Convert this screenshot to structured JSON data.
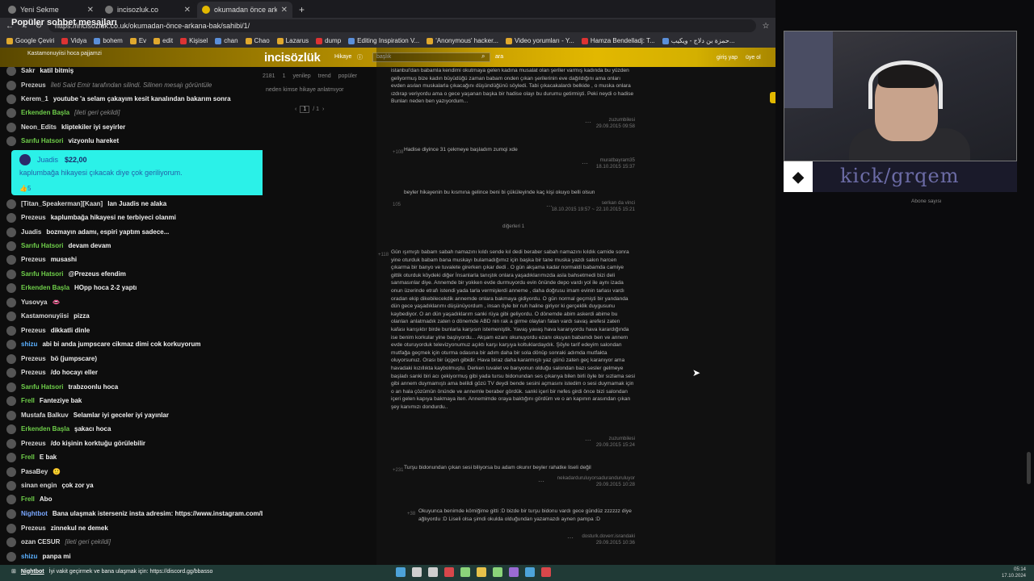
{
  "browser": {
    "tabs": [
      {
        "label": "Yeni Sekme",
        "active": false
      },
      {
        "label": "incisozluk.co",
        "active": false
      },
      {
        "label": "okumadan önce arkana bak - İ",
        "active": true
      }
    ],
    "new_tab_label": "+",
    "url": "https://incisozluk.co.uk/okumadan-önce-arkana-bak/sahibi/1/",
    "bookmarks": [
      "Google Çeviri",
      "Vidya",
      "bohem",
      "Ev",
      "edit",
      "Kişisel",
      "chan",
      "Chao",
      "Lazarus",
      "dump",
      "Editing Inspiration V...",
      "'Anonymous' hacker...",
      "Video yorumları - Y...",
      "Hamza Bendelladj: T...",
      "حمزة بن دلاج - ويكيب..."
    ]
  },
  "chat": {
    "title": "Popüler sohbet mesajları",
    "top_clip": "Kastamonuyiisi  hoca pajjamzi",
    "messages": [
      {
        "user": "Sakr",
        "text": "katil bitmiş",
        "color": "#d9d9d9",
        "muted": false
      },
      {
        "user": "Prezeus",
        "text": "İleti Said Emir tarafından silindi. Silinen mesajı görüntüle",
        "color": "#c8c8c8",
        "muted": true
      },
      {
        "user": "Kerem_1",
        "text": "youtube 'a selam çakayım kesit kanalından bakarım sonra",
        "color": "#d9d9d9",
        "muted": false
      },
      {
        "user": "Erkenden Başla",
        "text": "[ileti geri çekildi]",
        "color": "#6fcf4a",
        "muted": true
      },
      {
        "user": "Neon_Edits",
        "text": "kliptekiler iyi seyirler",
        "color": "#d9d9d9",
        "muted": false
      },
      {
        "user": "Sarıfu Hatsori",
        "text": "vizyonlu hareket",
        "color": "#6fcf4a",
        "muted": false
      },
      {
        "user": "[Titan_Speakerman][Kaan]",
        "text": "lan Juadis ne alaka",
        "color": "#d9d9d9",
        "muted": false
      },
      {
        "user": "Prezeus",
        "text": "kaplumbağa hikayesi ne terbiyeci olanmi",
        "color": "#d9d9d9",
        "muted": false
      },
      {
        "user": "Juadis",
        "text": "bozmayın adamı, espiri yaptım sadece...",
        "color": "#d9d9d9",
        "muted": false
      },
      {
        "user": "Sarıfu Hatsori",
        "text": "devam devam",
        "color": "#6fcf4a",
        "muted": false
      },
      {
        "user": "Prezeus",
        "text": "musashi",
        "color": "#d9d9d9",
        "muted": false
      },
      {
        "user": "Sarıfu Hatsori",
        "text": "@Prezeus efendim",
        "color": "#6fcf4a",
        "muted": false
      },
      {
        "user": "Erkenden Başla",
        "text": "HOpp hoca 2-2 yaptı",
        "color": "#6fcf4a",
        "muted": false
      },
      {
        "user": "Yusovya",
        "text": "👄",
        "color": "#d9d9d9",
        "muted": false
      },
      {
        "user": "Kastamonuyiisi",
        "text": "pizza",
        "color": "#d9d9d9",
        "muted": false
      },
      {
        "user": "Prezeus",
        "text": "dikkatli dinle",
        "color": "#d9d9d9",
        "muted": false
      },
      {
        "user": "shizu",
        "text": "abi bi anda jumpscare cikmaz dimi cok korkuyorum",
        "color": "#5ab0ff",
        "muted": false
      },
      {
        "user": "Prezeus",
        "text": "bö (jumpscare)",
        "color": "#d9d9d9",
        "muted": false
      },
      {
        "user": "Prezeus",
        "text": "/do hocayı eller",
        "color": "#d9d9d9",
        "muted": false
      },
      {
        "user": "Sarıfu Hatsori",
        "text": "trabzoonlu hoca",
        "color": "#6fcf4a",
        "muted": false
      },
      {
        "user": "Frell",
        "text": "Fanteziye bak",
        "color": "#6fcf4a",
        "muted": false
      },
      {
        "user": "Mustafa Balkuv",
        "text": "Selamlar iyi geceler iyi yayınlar",
        "color": "#d9d9d9",
        "muted": false
      },
      {
        "user": "Erkenden Başla",
        "text": "şakacı hoca",
        "color": "#6fcf4a",
        "muted": false
      },
      {
        "user": "Prezeus",
        "text": "/do kişinin korktuğu görülebilir",
        "color": "#d9d9d9",
        "muted": false
      },
      {
        "user": "Frell",
        "text": "E bak",
        "color": "#6fcf4a",
        "muted": false
      },
      {
        "user": "PasaBey",
        "text": "🙂",
        "color": "#d9d9d9",
        "muted": false
      },
      {
        "user": "sinan engin",
        "text": "çok zor ya",
        "color": "#d9d9d9",
        "muted": false
      },
      {
        "user": "Frell",
        "text": "Abo",
        "color": "#6fcf4a",
        "muted": false
      },
      {
        "user": "Nightbot",
        "text": "Bana ulaşmak isterseniz insta adresim: https://www.instagram.com/bbasso/",
        "color": "#7aa8ff",
        "muted": false
      },
      {
        "user": "Prezeus",
        "text": "zinnekul ne demek",
        "color": "#d9d9d9",
        "muted": false
      },
      {
        "user": "ozan CESUR",
        "text": "[ileti geri çekildi]",
        "color": "#d9d9d9",
        "muted": true
      },
      {
        "user": "shizu",
        "text": "panpa mi",
        "color": "#5ab0ff",
        "muted": false
      }
    ],
    "donation": {
      "user": "Juadis",
      "amount": "$22,00",
      "message": "kaplumbağa hikayesi çıkacak diye çok geriliyorum.",
      "likes": "5"
    }
  },
  "site": {
    "logo": "incisözlük",
    "nav_hikaye": "Hikaye",
    "search_placeholder": "başlık",
    "search_button": "ara",
    "login": "giriş yap",
    "register": "üye ol",
    "chat_bleed": "Kastamonuyiisi  hoca pajjamzi",
    "filters": [
      "2181",
      "1",
      "yenilер",
      "trend",
      "popüler"
    ],
    "topic_link": "neden kimse hikaye anlatmıyor",
    "pager_current": "1",
    "pager_total": "/ 1",
    "entries": [
      {
        "text": "istanbul'dan babamla kendimi okutmaya gelen kadına  musalat olan şeriler varmış kadında bu yüzden geliyormuş bize kadın büyüdüğü zaman babam onden çıkan şerilerinin eve dağıldığını ama onları evden asılan  muskalarla çıkacağını düşündüğünü söyledi. Tabi çıkacakalardı belkide , o muska onlara ızdırap veriyordu ama o gece yaşanan başka bir hadise olayı bu durumu getirmişti. Peki neydi o hadise Bunları neden ben yazıyordum...",
        "author": "zuzumbilesi",
        "date": "29.09.2015 09:58"
      },
      {
        "text": "Hadise diyince 31 çekmeye başladım zumqi xde",
        "author": "muratbayram35",
        "date": "18.10.2015 15:37",
        "votes": "+108"
      },
      {
        "text": "beyler hikayenin bu kısmına gelince beni bi çüküleyinde kaç kişi okuyo belli olsun",
        "author": "serkan da vinci",
        "date": "18.10.2015 19:57 ~ 22.10.2015 15:21",
        "votes": "105"
      },
      {
        "text": "Gün ışımıştı babam sabah namazını kıldı sende kıl dedi beraber sabah namazını kıldık camide sonra yine oturduk babam bana muskayı bulamadığımız için başka bir tane muska yazdı sakın harcen çıkarma bir banyo ve tuvalete girerken çıkar dedi . O gün akşama kadar normaldi babamda camiye gittik oturduk köydeki diğer İnsanlarla tanıştık onlara yaşadıklarımızda asla bahsetmedi bizi deli sanmasınlar diye. Annemde bir yokken evde durmuyordu evin önünde depo vardı yol ile aynı izada onun üzerinde etrafı istendi yada tarla vermişlerdi anneme , daha doğrusu imam evinin tarlası vardı oradan ekip dikebilecekdik annemde onlara bakmaya gidiyordu. O gün normal geçmişti bir yandanda dün gece yaşadıklarımı düşünüyordum , insan öyle bir ruh haline giriyor ki gerçeklik duygusunu kaybediyor. O an dün yaşadıklarım sanki rüya gibi geliyordu. O dönemde abim askerdi abime bu olanları anlatmadık zaten o dönemde ABD nin rak a girme olayları falan vardı savaş arefesi zaten kafası karışıktır birde bunlarla karşısın istemeniştik. Yavaş yavaş hava kararıyordu hava karardığında ise benim korkular yine başlıyordu... Akşam ezanı okunuyordu ezanı okuyan babamdı ben ve annem evde oturuyorduk televizyonumuz açıktı karşı karşıya koltuklardaydık. Şöyle tarif edeyim salondan mutfağa geçmek için oturma odasına bir adım daha bir sola dönüp sonraki adımda mutfakta oluyorsunuz. Orası bir üçgen gibidir. Hava biraz daha kararmıştı yaz günü zaten geç karanıyor ama havadaki kızıllıkta kaybolmuştu. Derken tuvalet ve banyonun olduğu salondan bazı sesler gelmeye başladı sanki biri acı çekiyormuş gibi yada tursu bidonundan ses çıkarıya bilen birli öyle bir sızlama sesi gibi annem duymamıştı ama belildi gözü TV deydi bende sesini açmasını istedim o sesi duymamak için o an hala çözümün önünde ve annemle beraber gördük. sanki içeri bir nefes girdi önce bizi salondan içeri gelen kapıya bakmaya iten. Annemimde oraya baktığını gördüm ve o an kapının arasından çıkan şey kanımızı dondurdu..",
        "author": "zuzumbilesi",
        "date": "29.09.2015 15:24",
        "votes": "+118"
      },
      {
        "text": "Turşu bidonundan çıkan sesi biliyorsa bu adam okunır beyler rahatke liseli değil",
        "author": "nekadarduruluyorsaduranduruluyor",
        "date": "29.09.2015 10:28",
        "votes": "+231"
      },
      {
        "text": "Okuyunca benimde kömiğime gitti :D bizde bir turşu bidonu vardı gece gündüz zzzzzz diye ağlıyordu :D Liseli olsa şimdi okulda olduğundan yazamazdı aynen pampa :D",
        "author": "dosturk.doverr.israndaki",
        "date": "29.09.2015 10:36",
        "votes": "+38"
      }
    ],
    "digerleri": "diğerleri 1"
  },
  "stream": {
    "kick_text": "kick/grqem",
    "abone_label": "Abone sayısı"
  },
  "taskbar": {
    "bot_name": "Nightbot",
    "bot_text": "İyi vakit geçirmek ve bana ulaşmak için: https://discord.gg/bbasso",
    "time": "05:14",
    "date": "17.10.2024"
  }
}
